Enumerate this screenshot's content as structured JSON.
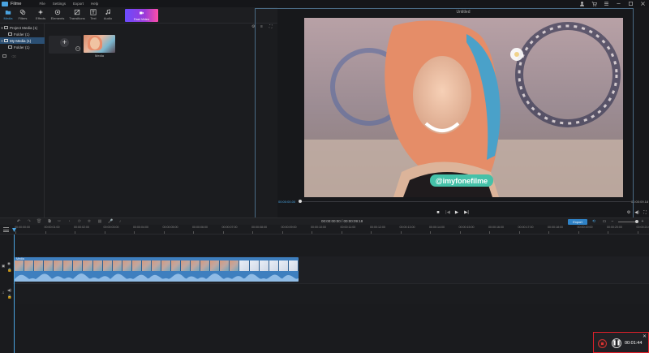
{
  "app": {
    "name": "iMyFone Filme",
    "title": "Filme"
  },
  "menu": [
    "File",
    "Settings",
    "Export",
    "Help"
  ],
  "toolbar": {
    "items": [
      {
        "label": "Media",
        "icon": "folder-icon",
        "active": true
      },
      {
        "label": "Filters",
        "icon": "filter-icon"
      },
      {
        "label": "Effects",
        "icon": "sparkle-icon"
      },
      {
        "label": "Elements",
        "icon": "elements-icon"
      },
      {
        "label": "Transitions",
        "icon": "transitions-icon"
      },
      {
        "label": "Text",
        "icon": "text-icon"
      },
      {
        "label": "Audio",
        "icon": "music-icon"
      }
    ],
    "fast_video": "Fast Video"
  },
  "tree": {
    "items": [
      {
        "label": "Project Media (1)",
        "level": 0
      },
      {
        "label": "Folder (1)",
        "level": 1
      },
      {
        "label": "My Media (1)",
        "level": 0,
        "selected": true
      },
      {
        "label": "Folder (1)",
        "level": 1
      }
    ]
  },
  "media": {
    "thumb_label": "Media"
  },
  "preview": {
    "title": "Untitled",
    "time_current": "00:00:00.00",
    "time_total": "00:00:09.18",
    "watermark": "@imyfonefilme"
  },
  "timeline": {
    "timecode": "00:00:00:00 / 00:00:09:18",
    "export_label": "Export",
    "ruler": [
      "00:00:00:00",
      "00:00:01:00",
      "00:00:02:00",
      "00:00:03:00",
      "00:00:04:00",
      "00:00:05:00",
      "00:00:06:00",
      "00:00:07:00",
      "00:00:08:00",
      "00:00:09:00",
      "00:00:10:00",
      "00:00:11:00",
      "00:00:12:00",
      "00:00:13:00",
      "00:00:14:00",
      "00:00:15:00",
      "00:00:16:00",
      "00:00:17:00",
      "00:00:18:00",
      "00:00:19:00",
      "00:00:20:00",
      "00:00:21:00"
    ],
    "clip_label": "Media"
  },
  "recorder": {
    "time": "00:01:44"
  },
  "colors": {
    "accent": "#4aa3df",
    "record": "#e0202a",
    "clip": "#3e7fbf",
    "selection": "#2b4f73"
  }
}
